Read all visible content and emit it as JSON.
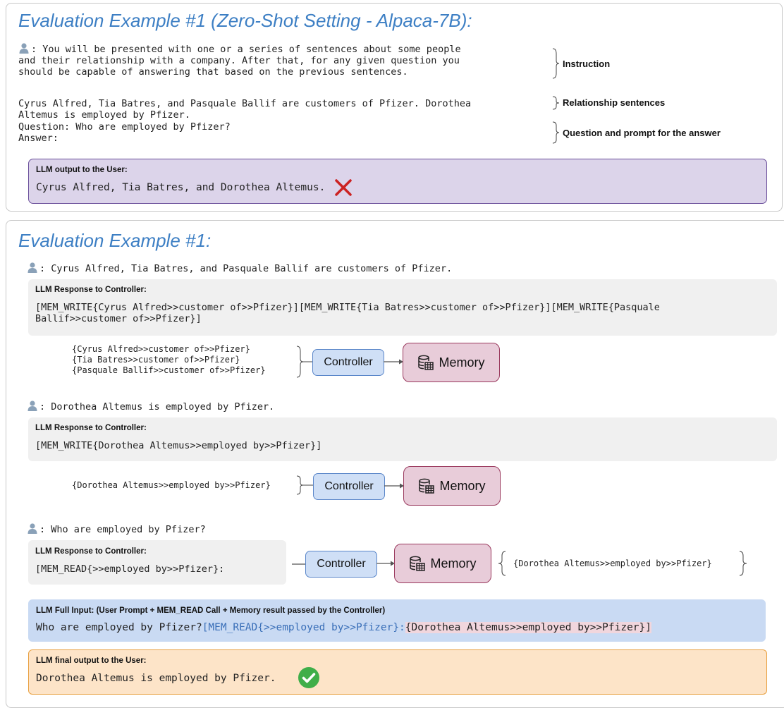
{
  "top_panel": {
    "title": "Evaluation Example #1 (Zero-Shot Setting - Alpaca-7B):",
    "instruction_lines": [
      ": You will be presented with one or a series of sentences about some people",
      "and their relationship with a company. After that, for any given question you",
      "should be capable of answering that based on the previous sentences."
    ],
    "relationship_lines": [
      "Cyrus Alfred, Tia Batres, and Pasquale Ballif are customers of Pfizer. Dorothea",
      "Altemus is employed by Pfizer."
    ],
    "question_lines": [
      "Question: Who are employed by Pfizer?",
      "Answer:"
    ],
    "labels": {
      "instruction": "Instruction",
      "relationship": "Relationship sentences",
      "question": "Question and prompt for the answer"
    },
    "output_label": "LLM output to the User:",
    "output_text": "Cyrus Alfred, Tia Batres, and Dorothea Altemus.",
    "output_mark": "cross-icon",
    "cross_color": "#cc2222"
  },
  "bottom_panel": {
    "title": "Evaluation Example #1:",
    "step1": {
      "user_text": ": Cyrus Alfred, Tia Batres, and Pasquale Ballif are customers of Pfizer.",
      "response_label": "LLM Response to Controller:",
      "response_lines": [
        "[MEM_WRITE{Cyrus Alfred>>customer of>>Pfizer}][MEM_WRITE{Tia Batres>>customer of>>Pfizer}][MEM_WRITE{Pasquale",
        "Ballif>>customer of>>Pfizer}]"
      ],
      "triples": [
        "{Cyrus Alfred>>customer of>>Pfizer}",
        "{Tia Batres>>customer of>>Pfizer}",
        "{Pasquale Ballif>>customer of>>Pfizer}"
      ]
    },
    "step2": {
      "user_text": ": Dorothea Altemus is employed by Pfizer.",
      "response_label": "LLM Response to Controller:",
      "response_text": "[MEM_WRITE{Dorothea Altemus>>employed by>>Pfizer}]",
      "triple": "{Dorothea Altemus>>employed by>>Pfizer}"
    },
    "step3": {
      "user_text": ": Who are employed by Pfizer?",
      "response_label": "LLM Response to Controller:",
      "response_text": "[MEM_READ{>>employed by>>Pfizer}:",
      "result": "{Dorothea Altemus>>employed by>>Pfizer}"
    },
    "controller_label": "Controller",
    "memory_label": "Memory",
    "full_input_label": "LLM Full Input: (User Prompt + MEM_READ Call + Memory result passed by the Controller)",
    "full_input": {
      "prompt": "Who are employed by Pfizer?",
      "read_call": "[MEM_READ{>>employed by>>Pfizer}:",
      "memory_result": "{Dorothea Altemus>>employed by>>Pfizer}]"
    },
    "final_label": "LLM final output to the User:",
    "final_text": "Dorothea Altemus is employed by Pfizer.",
    "final_mark": "check-circle-icon",
    "check_color": "#3fae49"
  },
  "colors": {
    "title_blue": "#3d7fc4",
    "output_purple": "#dcd4ea",
    "controller_blue": "#cfdff6",
    "memory_pink": "#e8ccd9",
    "final_orange": "#fde4c8"
  }
}
